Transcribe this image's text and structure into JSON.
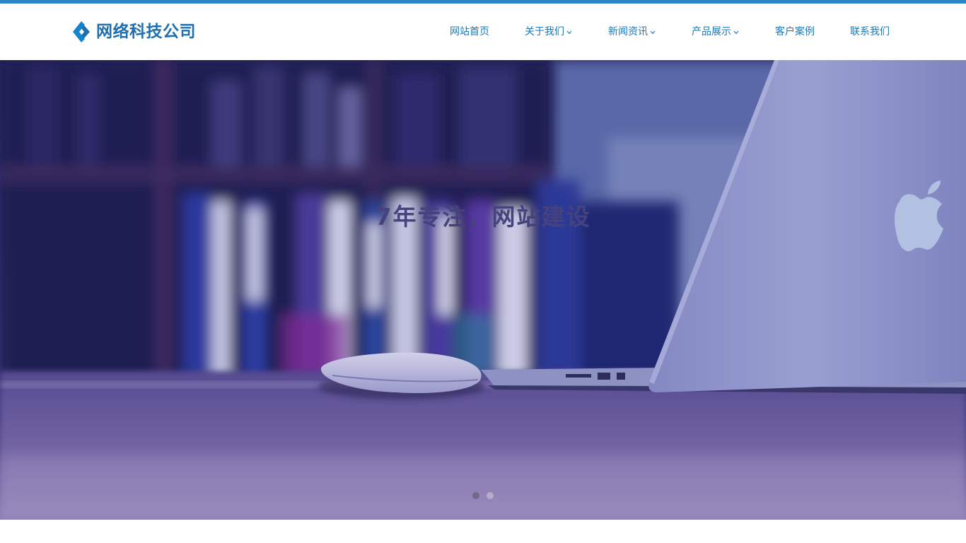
{
  "brand": {
    "name": "网络科技公司",
    "color": "#1f6fae",
    "accent": "#2a86c4"
  },
  "nav": {
    "items": [
      {
        "label": "网站首页",
        "has_dropdown": false
      },
      {
        "label": "关于我们",
        "has_dropdown": true
      },
      {
        "label": "新闻资讯",
        "has_dropdown": true
      },
      {
        "label": "产品展示",
        "has_dropdown": true
      },
      {
        "label": "客户案例",
        "has_dropdown": false
      },
      {
        "label": "联系我们",
        "has_dropdown": false
      }
    ],
    "text_color": "#1a78b4"
  },
  "hero": {
    "title": "7年专注，网站建设",
    "slides_count": 2,
    "active_slide": 1,
    "icons": [
      "laptop-image",
      "mouse-image",
      "bookshelf-image"
    ]
  }
}
